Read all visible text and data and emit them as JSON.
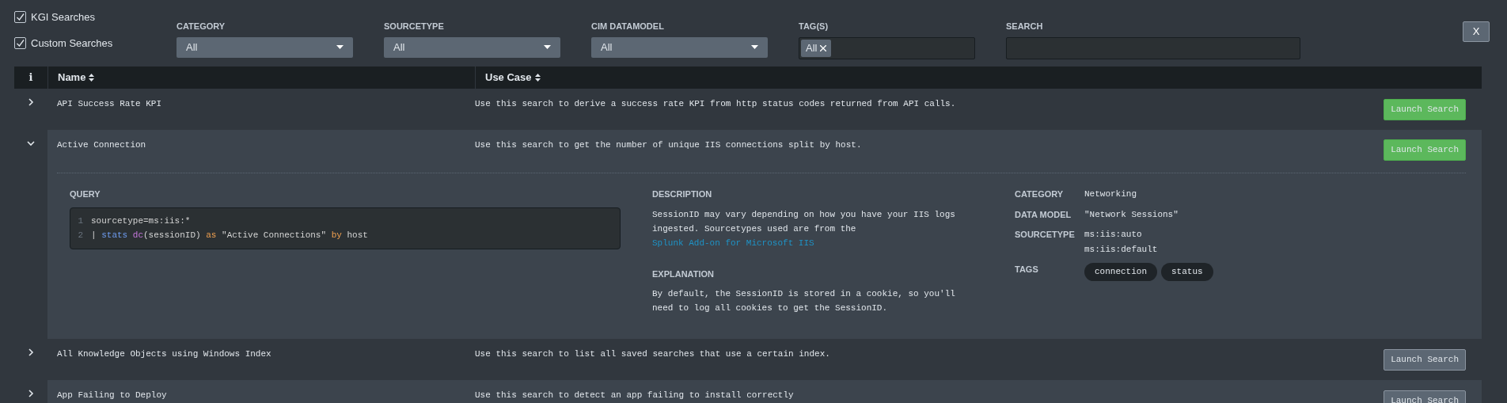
{
  "sources": [
    {
      "label": "KGI Searches",
      "checked": true
    },
    {
      "label": "Custom Searches",
      "checked": true
    }
  ],
  "filters": [
    {
      "kind": "select",
      "label": "CATEGORY",
      "value": "All"
    },
    {
      "kind": "select",
      "label": "SOURCETYPE",
      "value": "All"
    },
    {
      "kind": "select",
      "label": "CIM DATAMODEL",
      "value": "All"
    },
    {
      "kind": "tags",
      "label": "TAG(S)",
      "tags": [
        "All"
      ]
    },
    {
      "kind": "search",
      "label": "SEARCH"
    }
  ],
  "close_button": "X",
  "table": {
    "info_header": "i",
    "columns": [
      "Name",
      "Use Case"
    ],
    "rows": [
      {
        "name": "API Success Rate KPI",
        "use_case": "Use this search to derive a success rate KPI from http status codes returned from API calls.",
        "expanded": false,
        "button": "Launch Search",
        "highlighted": true
      },
      {
        "name": "Active Connection",
        "use_case": "Use this search to get the number of unique IIS connections split by host.",
        "expanded": true,
        "button": "Launch Search",
        "highlighted": true,
        "details": {
          "query_label": "QUERY",
          "query": [
            {
              "number": "1",
              "tokens": [
                {
                  "kind": "plain",
                  "text": "sourcetype=ms:iis:*"
                }
              ]
            },
            {
              "number": "2",
              "tokens": [
                {
                  "kind": "plain",
                  "text": "| "
                },
                {
                  "kind": "command",
                  "text": "stats "
                },
                {
                  "kind": "function",
                  "text": "dc"
                },
                {
                  "kind": "plain",
                  "text": "(sessionID) "
                },
                {
                  "kind": "keyword",
                  "text": "as"
                },
                {
                  "kind": "plain",
                  "text": " \"Active Connections\" "
                },
                {
                  "kind": "keyword",
                  "text": "by"
                },
                {
                  "kind": "plain",
                  "text": " host"
                }
              ]
            }
          ],
          "description_label": "DESCRIPTION",
          "description": "SessionID may vary depending on how you have your IIS logs ingested. Sourcetypes used are from the",
          "description_link": "Splunk Add-on for Microsoft IIS",
          "explanation_label": "EXPLANATION",
          "explanation": "By default, the SessionID is stored in a cookie, so you'll need to log all cookies to get the SessionID.",
          "meta": [
            {
              "label": "CATEGORY",
              "values": [
                "Networking"
              ]
            },
            {
              "label": "DATA MODEL",
              "values": [
                "\"Network Sessions\""
              ]
            },
            {
              "label": "SOURCETYPE",
              "values": [
                "ms:iis:auto",
                "ms:iis:default"
              ]
            }
          ],
          "tags_label": "TAGS",
          "tags": [
            "connection",
            "status"
          ]
        }
      },
      {
        "name": "All Knowledge Objects using Windows Index",
        "use_case": "Use this search to list all saved searches that use a certain index.",
        "expanded": false,
        "button": "Launch Search",
        "highlighted": false
      },
      {
        "name": "App Failing to Deploy",
        "use_case": "Use this search to detect an app failing to install correctly",
        "expanded": false,
        "button": "Launch Search",
        "highlighted": false
      }
    ]
  }
}
